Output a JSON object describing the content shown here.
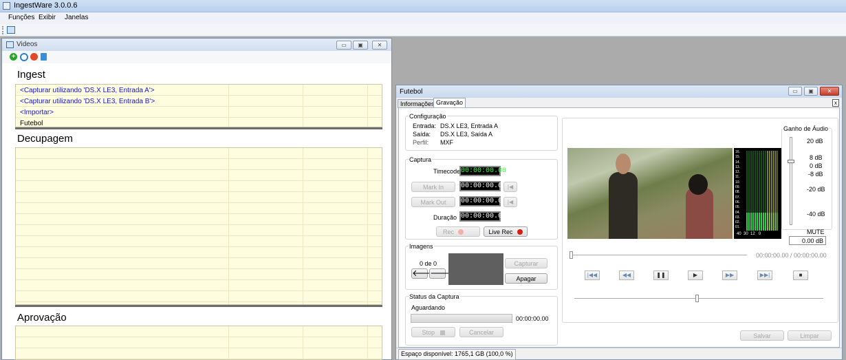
{
  "app": {
    "title": "IngestWare 3.0.0.6"
  },
  "menu": [
    "Funções",
    "Exibir",
    "Janelas"
  ],
  "videos_window": {
    "title": "Videos",
    "sections": {
      "ingest": {
        "title": "Ingest",
        "items": [
          "<Capturar utilizando 'DS.X LE3, Entrada A'>",
          "<Capturar utilizando 'DS.X LE3, Entrada B'>",
          "<Importar>",
          "Futebol"
        ]
      },
      "decupagem": {
        "title": "Decupagem"
      },
      "aprovacao": {
        "title": "Aprovação"
      }
    }
  },
  "futebol_window": {
    "title": "Futebol",
    "tabs": [
      "Informações",
      "Gravação"
    ],
    "close_x": "x",
    "configuracao": {
      "label": "Configuração",
      "entrada_label": "Entrada:",
      "entrada": "DS.X LE3, Entrada A",
      "saida_label": "Saída:",
      "saida": "DS.X LE3, Saída A",
      "perfil_label": "Perfil:",
      "perfil": "MXF"
    },
    "captura": {
      "label": "Captura",
      "timecode_label": "Timecode",
      "timecode": "00:00:00.00",
      "mark_in": "Mark In",
      "mark_in_tc": "00:00:00.00",
      "mark_out": "Mark Out",
      "mark_out_tc": "00:00:00.00",
      "duracao_label": "Duração",
      "duracao": "00:00:00.00",
      "rec": "Rec",
      "live_rec": "Live Rec"
    },
    "imagens": {
      "label": "Imagens",
      "count": "0 de 0",
      "capturar": "Capturar",
      "apagar": "Apagar"
    },
    "status_captura": {
      "label": "Status da Captura",
      "state": "Aguardando",
      "time": "00:00:00.00",
      "stop": "Stop",
      "cancelar": "Cancelar"
    },
    "audio": {
      "label": "Ganho de Áudio",
      "scale": [
        "20 dB",
        "8 dB",
        "0 dB",
        "-8 dB",
        "-20 dB",
        "-40 dB",
        "MUTE"
      ],
      "value": "0.00 dB"
    },
    "meter_labels": [
      "16",
      "15",
      "14",
      "13",
      "12",
      "11",
      "10",
      "09",
      "08",
      "07",
      "06",
      "05",
      "04",
      "03",
      "02",
      "01"
    ],
    "meter_scale": "40  30  12   0",
    "playback_time": "00:00:00.00 / 00:00:00.00",
    "salvar": "Salvar",
    "limpar": "Limpar",
    "status_bar": "Espaço disponível: 1765,1 GB (100,0 %)"
  }
}
